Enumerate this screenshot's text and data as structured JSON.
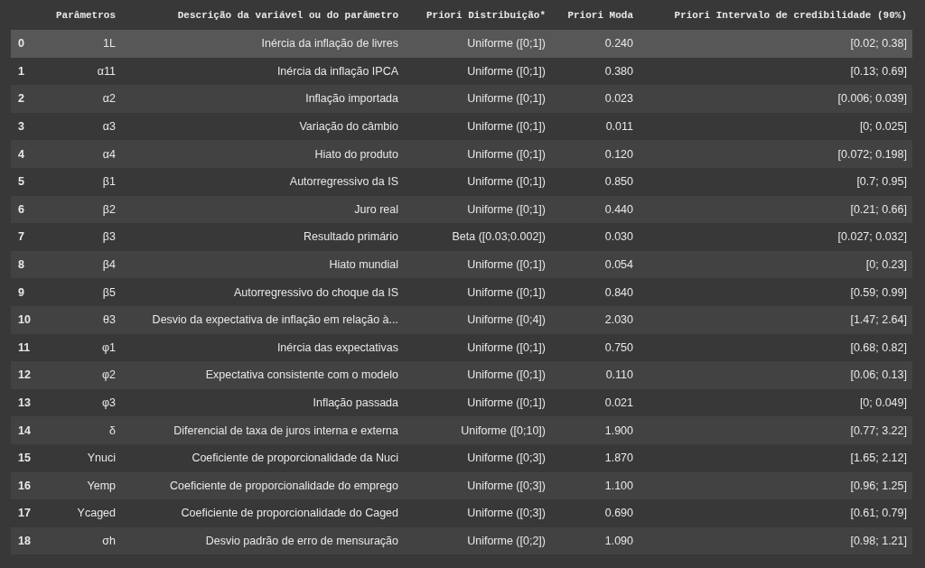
{
  "table": {
    "columns": [
      "Parâmetros",
      "Descrição da variável ou do parâmetro",
      "Priori Distribuição*",
      "Priori Moda",
      "Priori Intervalo de credibilidade (90%)"
    ],
    "rows": [
      {
        "index": "0",
        "cells": [
          "1L",
          "Inércia da inflação de livres",
          "Uniforme ([0;1])",
          "0.240",
          "[0.02; 0.38]"
        ],
        "selected": true
      },
      {
        "index": "1",
        "cells": [
          "α11",
          "Inércia da inflação IPCA",
          "Uniforme ([0;1])",
          "0.380",
          "[0.13; 0.69]"
        ],
        "selected": false
      },
      {
        "index": "2",
        "cells": [
          "α2",
          "Inflação importada",
          "Uniforme ([0;1])",
          "0.023",
          "[0.006; 0.039]"
        ],
        "selected": false
      },
      {
        "index": "3",
        "cells": [
          "α3",
          "Variação do câmbio",
          "Uniforme ([0;1])",
          "0.011",
          "[0; 0.025]"
        ],
        "selected": false
      },
      {
        "index": "4",
        "cells": [
          "α4",
          "Hiato do produto",
          "Uniforme ([0;1])",
          "0.120",
          "[0.072; 0.198]"
        ],
        "selected": false
      },
      {
        "index": "5",
        "cells": [
          "β1",
          "Autorregressivo da IS",
          "Uniforme ([0;1])",
          "0.850",
          "[0.7; 0.95]"
        ],
        "selected": false
      },
      {
        "index": "6",
        "cells": [
          "β2",
          "Juro real",
          "Uniforme ([0;1])",
          "0.440",
          "[0.21; 0.66]"
        ],
        "selected": false
      },
      {
        "index": "7",
        "cells": [
          "β3",
          "Resultado primário",
          "Beta ([0.03;0.002])",
          "0.030",
          "[0.027; 0.032]"
        ],
        "selected": false
      },
      {
        "index": "8",
        "cells": [
          "β4",
          "Hiato mundial",
          "Uniforme ([0;1])",
          "0.054",
          "[0; 0.23]"
        ],
        "selected": false
      },
      {
        "index": "9",
        "cells": [
          "β5",
          "Autorregressivo do choque da IS",
          "Uniforme ([0;1])",
          "0.840",
          "[0.59; 0.99]"
        ],
        "selected": false
      },
      {
        "index": "10",
        "cells": [
          "θ3",
          "Desvio da expectativa de inflação em relação à...",
          "Uniforme ([0;4])",
          "2.030",
          "[1.47; 2.64]"
        ],
        "selected": false
      },
      {
        "index": "11",
        "cells": [
          "φ1",
          "Inércia das expectativas",
          "Uniforme ([0;1])",
          "0.750",
          "[0.68; 0.82]"
        ],
        "selected": false
      },
      {
        "index": "12",
        "cells": [
          "φ2",
          "Expectativa consistente com o modelo",
          "Uniforme ([0;1])",
          "0.110",
          "[0.06; 0.13]"
        ],
        "selected": false
      },
      {
        "index": "13",
        "cells": [
          "φ3",
          "Inflação passada",
          "Uniforme ([0;1])",
          "0.021",
          "[0; 0.049]"
        ],
        "selected": false
      },
      {
        "index": "14",
        "cells": [
          "δ",
          "Diferencial de taxa de juros interna e externa",
          "Uniforme ([0;10])",
          "1.900",
          "[0.77; 3.22]"
        ],
        "selected": false
      },
      {
        "index": "15",
        "cells": [
          "Ynuci",
          "Coeficiente de proporcionalidade da Nuci",
          "Uniforme ([0;3])",
          "1.870",
          "[1.65; 2.12]"
        ],
        "selected": false
      },
      {
        "index": "16",
        "cells": [
          "Yemp",
          "Coeficiente de proporcionalidade do emprego",
          "Uniforme ([0;3])",
          "1.100",
          "[0.96; 1.25]"
        ],
        "selected": false
      },
      {
        "index": "17",
        "cells": [
          "Ycaged",
          "Coeficiente de proporcionalidade do Caged",
          "Uniforme ([0;3])",
          "0.690",
          "[0.61; 0.79]"
        ],
        "selected": false
      },
      {
        "index": "18",
        "cells": [
          "σh",
          "Desvio padrão de erro de mensuração",
          "Uniforme ([0;2])",
          "1.090",
          "[0.98; 1.21]"
        ],
        "selected": false
      }
    ]
  }
}
